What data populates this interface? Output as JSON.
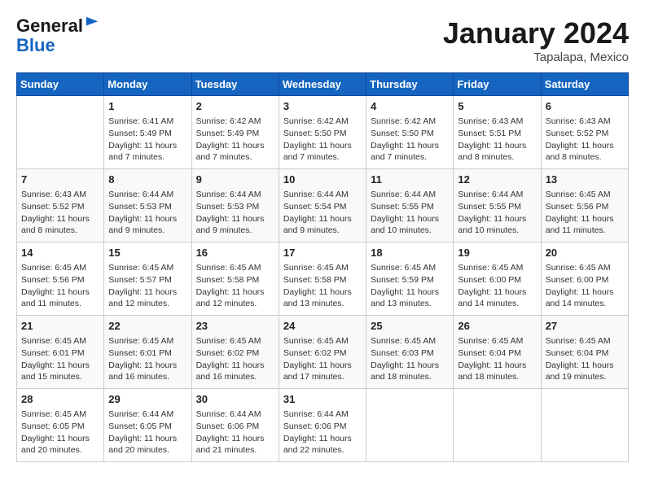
{
  "header": {
    "logo_general": "General",
    "logo_blue": "Blue",
    "month": "January 2024",
    "location": "Tapalapa, Mexico"
  },
  "days_of_week": [
    "Sunday",
    "Monday",
    "Tuesday",
    "Wednesday",
    "Thursday",
    "Friday",
    "Saturday"
  ],
  "weeks": [
    [
      {
        "day": "",
        "content": ""
      },
      {
        "day": "1",
        "content": "Sunrise: 6:41 AM\nSunset: 5:49 PM\nDaylight: 11 hours and 7 minutes."
      },
      {
        "day": "2",
        "content": "Sunrise: 6:42 AM\nSunset: 5:49 PM\nDaylight: 11 hours and 7 minutes."
      },
      {
        "day": "3",
        "content": "Sunrise: 6:42 AM\nSunset: 5:50 PM\nDaylight: 11 hours and 7 minutes."
      },
      {
        "day": "4",
        "content": "Sunrise: 6:42 AM\nSunset: 5:50 PM\nDaylight: 11 hours and 7 minutes."
      },
      {
        "day": "5",
        "content": "Sunrise: 6:43 AM\nSunset: 5:51 PM\nDaylight: 11 hours and 8 minutes."
      },
      {
        "day": "6",
        "content": "Sunrise: 6:43 AM\nSunset: 5:52 PM\nDaylight: 11 hours and 8 minutes."
      }
    ],
    [
      {
        "day": "7",
        "content": "Sunrise: 6:43 AM\nSunset: 5:52 PM\nDaylight: 11 hours and 8 minutes."
      },
      {
        "day": "8",
        "content": "Sunrise: 6:44 AM\nSunset: 5:53 PM\nDaylight: 11 hours and 9 minutes."
      },
      {
        "day": "9",
        "content": "Sunrise: 6:44 AM\nSunset: 5:53 PM\nDaylight: 11 hours and 9 minutes."
      },
      {
        "day": "10",
        "content": "Sunrise: 6:44 AM\nSunset: 5:54 PM\nDaylight: 11 hours and 9 minutes."
      },
      {
        "day": "11",
        "content": "Sunrise: 6:44 AM\nSunset: 5:55 PM\nDaylight: 11 hours and 10 minutes."
      },
      {
        "day": "12",
        "content": "Sunrise: 6:44 AM\nSunset: 5:55 PM\nDaylight: 11 hours and 10 minutes."
      },
      {
        "day": "13",
        "content": "Sunrise: 6:45 AM\nSunset: 5:56 PM\nDaylight: 11 hours and 11 minutes."
      }
    ],
    [
      {
        "day": "14",
        "content": "Sunrise: 6:45 AM\nSunset: 5:56 PM\nDaylight: 11 hours and 11 minutes."
      },
      {
        "day": "15",
        "content": "Sunrise: 6:45 AM\nSunset: 5:57 PM\nDaylight: 11 hours and 12 minutes."
      },
      {
        "day": "16",
        "content": "Sunrise: 6:45 AM\nSunset: 5:58 PM\nDaylight: 11 hours and 12 minutes."
      },
      {
        "day": "17",
        "content": "Sunrise: 6:45 AM\nSunset: 5:58 PM\nDaylight: 11 hours and 13 minutes."
      },
      {
        "day": "18",
        "content": "Sunrise: 6:45 AM\nSunset: 5:59 PM\nDaylight: 11 hours and 13 minutes."
      },
      {
        "day": "19",
        "content": "Sunrise: 6:45 AM\nSunset: 6:00 PM\nDaylight: 11 hours and 14 minutes."
      },
      {
        "day": "20",
        "content": "Sunrise: 6:45 AM\nSunset: 6:00 PM\nDaylight: 11 hours and 14 minutes."
      }
    ],
    [
      {
        "day": "21",
        "content": "Sunrise: 6:45 AM\nSunset: 6:01 PM\nDaylight: 11 hours and 15 minutes."
      },
      {
        "day": "22",
        "content": "Sunrise: 6:45 AM\nSunset: 6:01 PM\nDaylight: 11 hours and 16 minutes."
      },
      {
        "day": "23",
        "content": "Sunrise: 6:45 AM\nSunset: 6:02 PM\nDaylight: 11 hours and 16 minutes."
      },
      {
        "day": "24",
        "content": "Sunrise: 6:45 AM\nSunset: 6:02 PM\nDaylight: 11 hours and 17 minutes."
      },
      {
        "day": "25",
        "content": "Sunrise: 6:45 AM\nSunset: 6:03 PM\nDaylight: 11 hours and 18 minutes."
      },
      {
        "day": "26",
        "content": "Sunrise: 6:45 AM\nSunset: 6:04 PM\nDaylight: 11 hours and 18 minutes."
      },
      {
        "day": "27",
        "content": "Sunrise: 6:45 AM\nSunset: 6:04 PM\nDaylight: 11 hours and 19 minutes."
      }
    ],
    [
      {
        "day": "28",
        "content": "Sunrise: 6:45 AM\nSunset: 6:05 PM\nDaylight: 11 hours and 20 minutes."
      },
      {
        "day": "29",
        "content": "Sunrise: 6:44 AM\nSunset: 6:05 PM\nDaylight: 11 hours and 20 minutes."
      },
      {
        "day": "30",
        "content": "Sunrise: 6:44 AM\nSunset: 6:06 PM\nDaylight: 11 hours and 21 minutes."
      },
      {
        "day": "31",
        "content": "Sunrise: 6:44 AM\nSunset: 6:06 PM\nDaylight: 11 hours and 22 minutes."
      },
      {
        "day": "",
        "content": ""
      },
      {
        "day": "",
        "content": ""
      },
      {
        "day": "",
        "content": ""
      }
    ]
  ]
}
